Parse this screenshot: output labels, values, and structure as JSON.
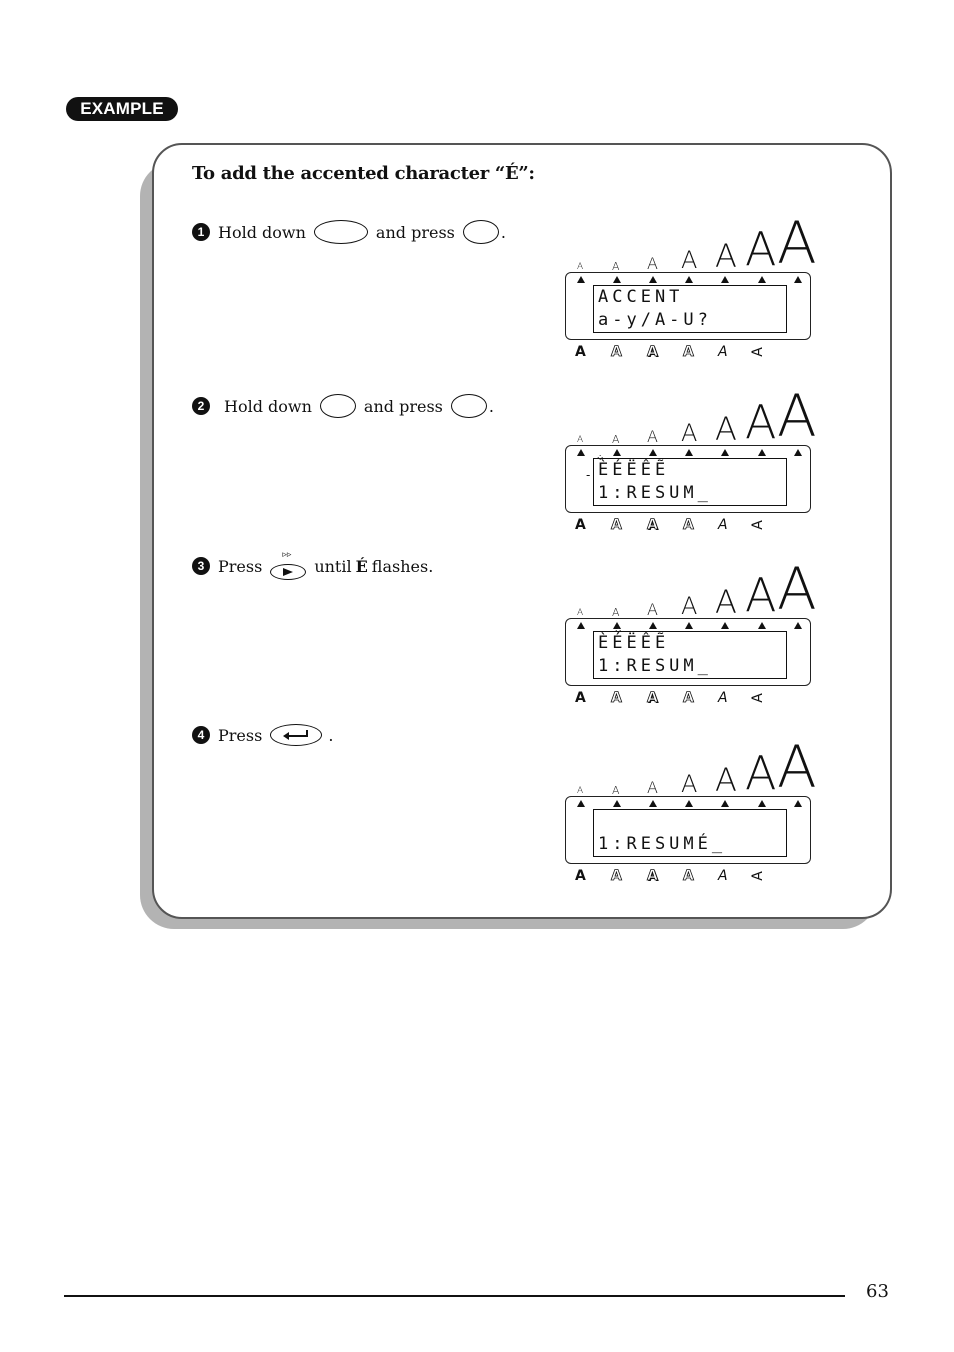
{
  "badge": "EXAMPLE",
  "title": "To add the accented character “É”:",
  "steps": [
    {
      "num": "1",
      "text1": "Hold down",
      "key1": "code-key",
      "text2": "and press",
      "key2": "a-key",
      "end": "."
    },
    {
      "num": "2",
      "text1": "Hold down",
      "key1": "a-key",
      "text2": "and press",
      "key2": "e-key",
      "end": "."
    },
    {
      "num": "3",
      "text1": "Press",
      "key1": "cursor-right-key",
      "text2": "until",
      "bold": "É",
      "text3": "flashes."
    },
    {
      "num": "4",
      "text1": "Press",
      "key1": "enter-key",
      "end": "."
    }
  ],
  "lcd": {
    "size_indicators": [
      "A",
      "A",
      "A",
      "A",
      "A",
      "A",
      "A"
    ],
    "style_indicators": [
      "A",
      "A",
      "A",
      "A",
      "A",
      "A"
    ],
    "displays": [
      {
        "line1": "ACCENT",
        "line2": "a-y/A-U?"
      },
      {
        "line1": "ÈÉËÊẼ",
        "line2": "1:RESUM_",
        "flashing": "È"
      },
      {
        "line1": "ÈÉËÊẼ",
        "line2": "1:RESUM_",
        "flashing": "É"
      },
      {
        "line1": "",
        "line2": "1:RESUMÉ_"
      }
    ]
  },
  "page_number": "63"
}
